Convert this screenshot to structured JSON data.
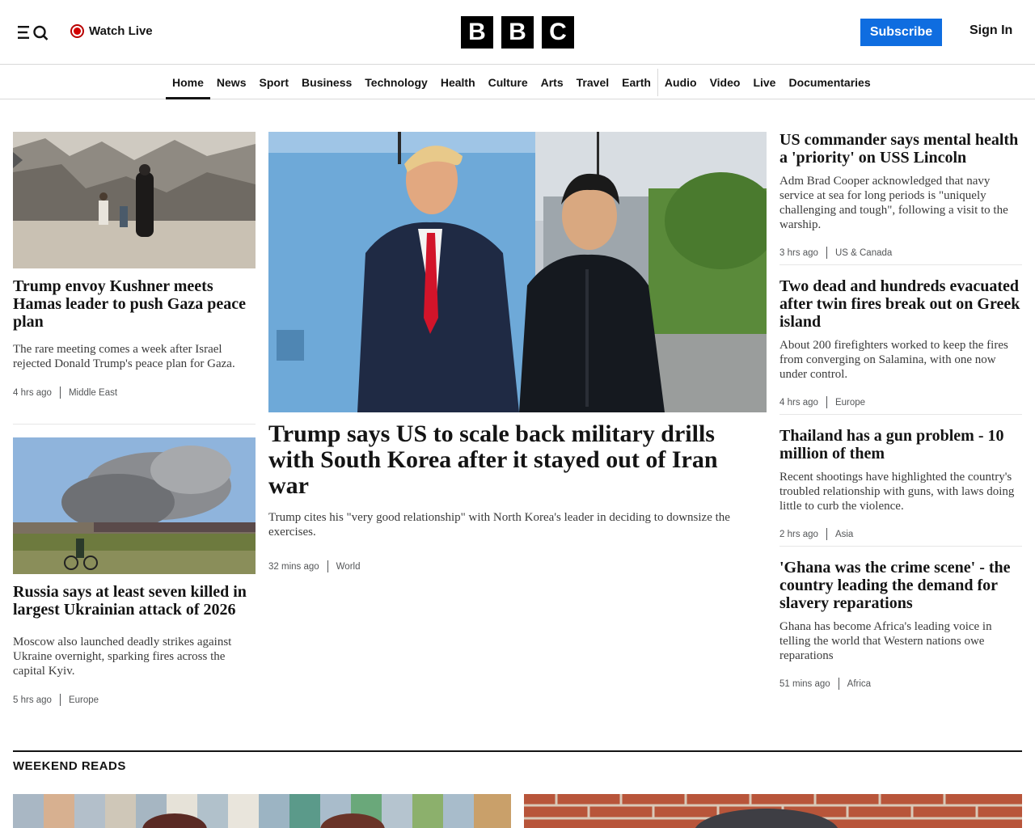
{
  "header": {
    "watch_live": "Watch Live",
    "logo_letters": [
      "B",
      "B",
      "C"
    ],
    "subscribe": "Subscribe",
    "sign_in": "Sign In"
  },
  "nav": {
    "items": [
      "Home",
      "News",
      "Sport",
      "Business",
      "Technology",
      "Health",
      "Culture",
      "Arts",
      "Travel",
      "Earth",
      "Audio",
      "Video",
      "Live",
      "Documentaries"
    ],
    "active": "Home"
  },
  "left": [
    {
      "headline": "Trump envoy Kushner meets Hamas leader to push Gaza peace plan",
      "summary": "The rare meeting comes a week after Israel rejected Donald Trump's peace plan for Gaza.",
      "time": "4 hrs ago",
      "section": "Middle East"
    },
    {
      "headline": "Russia says at least seven killed in largest Ukrainian attack of 2026",
      "summary": "Moscow also launched deadly strikes against Ukraine overnight, sparking fires across the capital Kyiv.",
      "time": "5 hrs ago",
      "section": "Europe"
    }
  ],
  "lead": {
    "headline": "Trump says US to scale back military drills with South Korea after it stayed out of Iran war",
    "summary": "Trump cites his \"very good relationship\" with North Korea's leader in deciding to downsize the exercises.",
    "time": "32 mins ago",
    "section": "World"
  },
  "right": [
    {
      "headline": "US commander says mental health a 'priority' on USS Lincoln",
      "summary": "Adm Brad Cooper acknowledged that navy service at sea for long periods is \"uniquely challenging and tough\", following a visit to the warship.",
      "time": "3 hrs ago",
      "section": "US & Canada"
    },
    {
      "headline": "Two dead and hundreds evacuated after twin fires break out on Greek island",
      "summary": "About 200 firefighters worked to keep the fires from converging on Salamina, with one now under control.",
      "time": "4 hrs ago",
      "section": "Europe"
    },
    {
      "headline": "Thailand has a gun problem - 10 million of them",
      "summary": "Recent shootings have highlighted the country's troubled relationship with guns, with laws doing little to curb the violence.",
      "time": "2 hrs ago",
      "section": "Asia"
    },
    {
      "headline": "'Ghana was the crime scene' - the country leading the demand for slavery reparations",
      "summary": "Ghana has become Africa's leading voice in telling the world that Western nations owe reparations",
      "time": "51 mins ago",
      "section": "Africa"
    }
  ],
  "weekend": {
    "title": "WEEKEND READS"
  }
}
